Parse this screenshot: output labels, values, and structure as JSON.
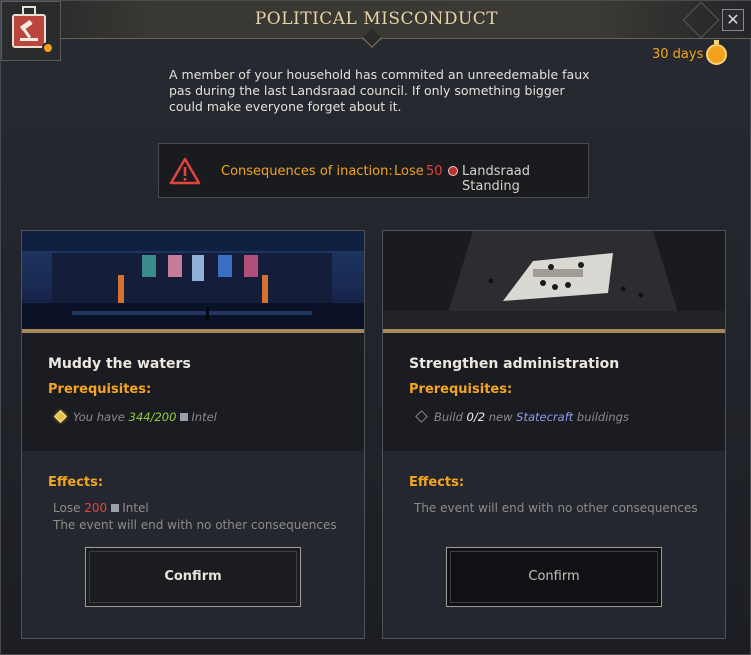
{
  "window": {
    "title": "POLITICAL MISCONDUCT",
    "close_label": "✕",
    "event_icon": "gavel-icon"
  },
  "timer": {
    "label": "30 days",
    "icon": "stopwatch-icon"
  },
  "description": "A member of your household has commited an unreedemable faux pas during the last Landsraad council. If only something bigger could make everyone forget about it.",
  "consequences": {
    "label": "Consequences of inaction:",
    "lose_text": "Lose",
    "amount": "50",
    "resource": "Landsraad Standing",
    "warning_icon": "warning-triangle-icon"
  },
  "options": [
    {
      "title": "Muddy the waters",
      "prereq_label": "Prerequisites:",
      "prereq": {
        "met": true,
        "prefix": "You have",
        "current": "344",
        "sep": "/",
        "required": "200",
        "resource": "Intel"
      },
      "effects_label": "Effects:",
      "effects": {
        "line1_prefix": "Lose",
        "line1_amount": "200",
        "line1_resource": "Intel",
        "line2": "The event will end with no other consequences"
      },
      "confirm_label": "Confirm"
    },
    {
      "title": "Strengthen administration",
      "prereq_label": "Prerequisites:",
      "prereq": {
        "met": false,
        "prefix": "Build",
        "current": "0",
        "sep": "/",
        "required": "2",
        "word_new": "new",
        "category": "Statecraft",
        "suffix": "buildings"
      },
      "effects_label": "Effects:",
      "effects": {
        "line1": "The event will end with no other consequences"
      },
      "confirm_label": "Confirm"
    }
  ],
  "colors": {
    "accent_orange": "#f3a51f",
    "negative_red": "#e0443c",
    "positive_green": "#8fce3e",
    "link_blue": "#8e9fe8",
    "title_gold": "#e6d3a7"
  }
}
